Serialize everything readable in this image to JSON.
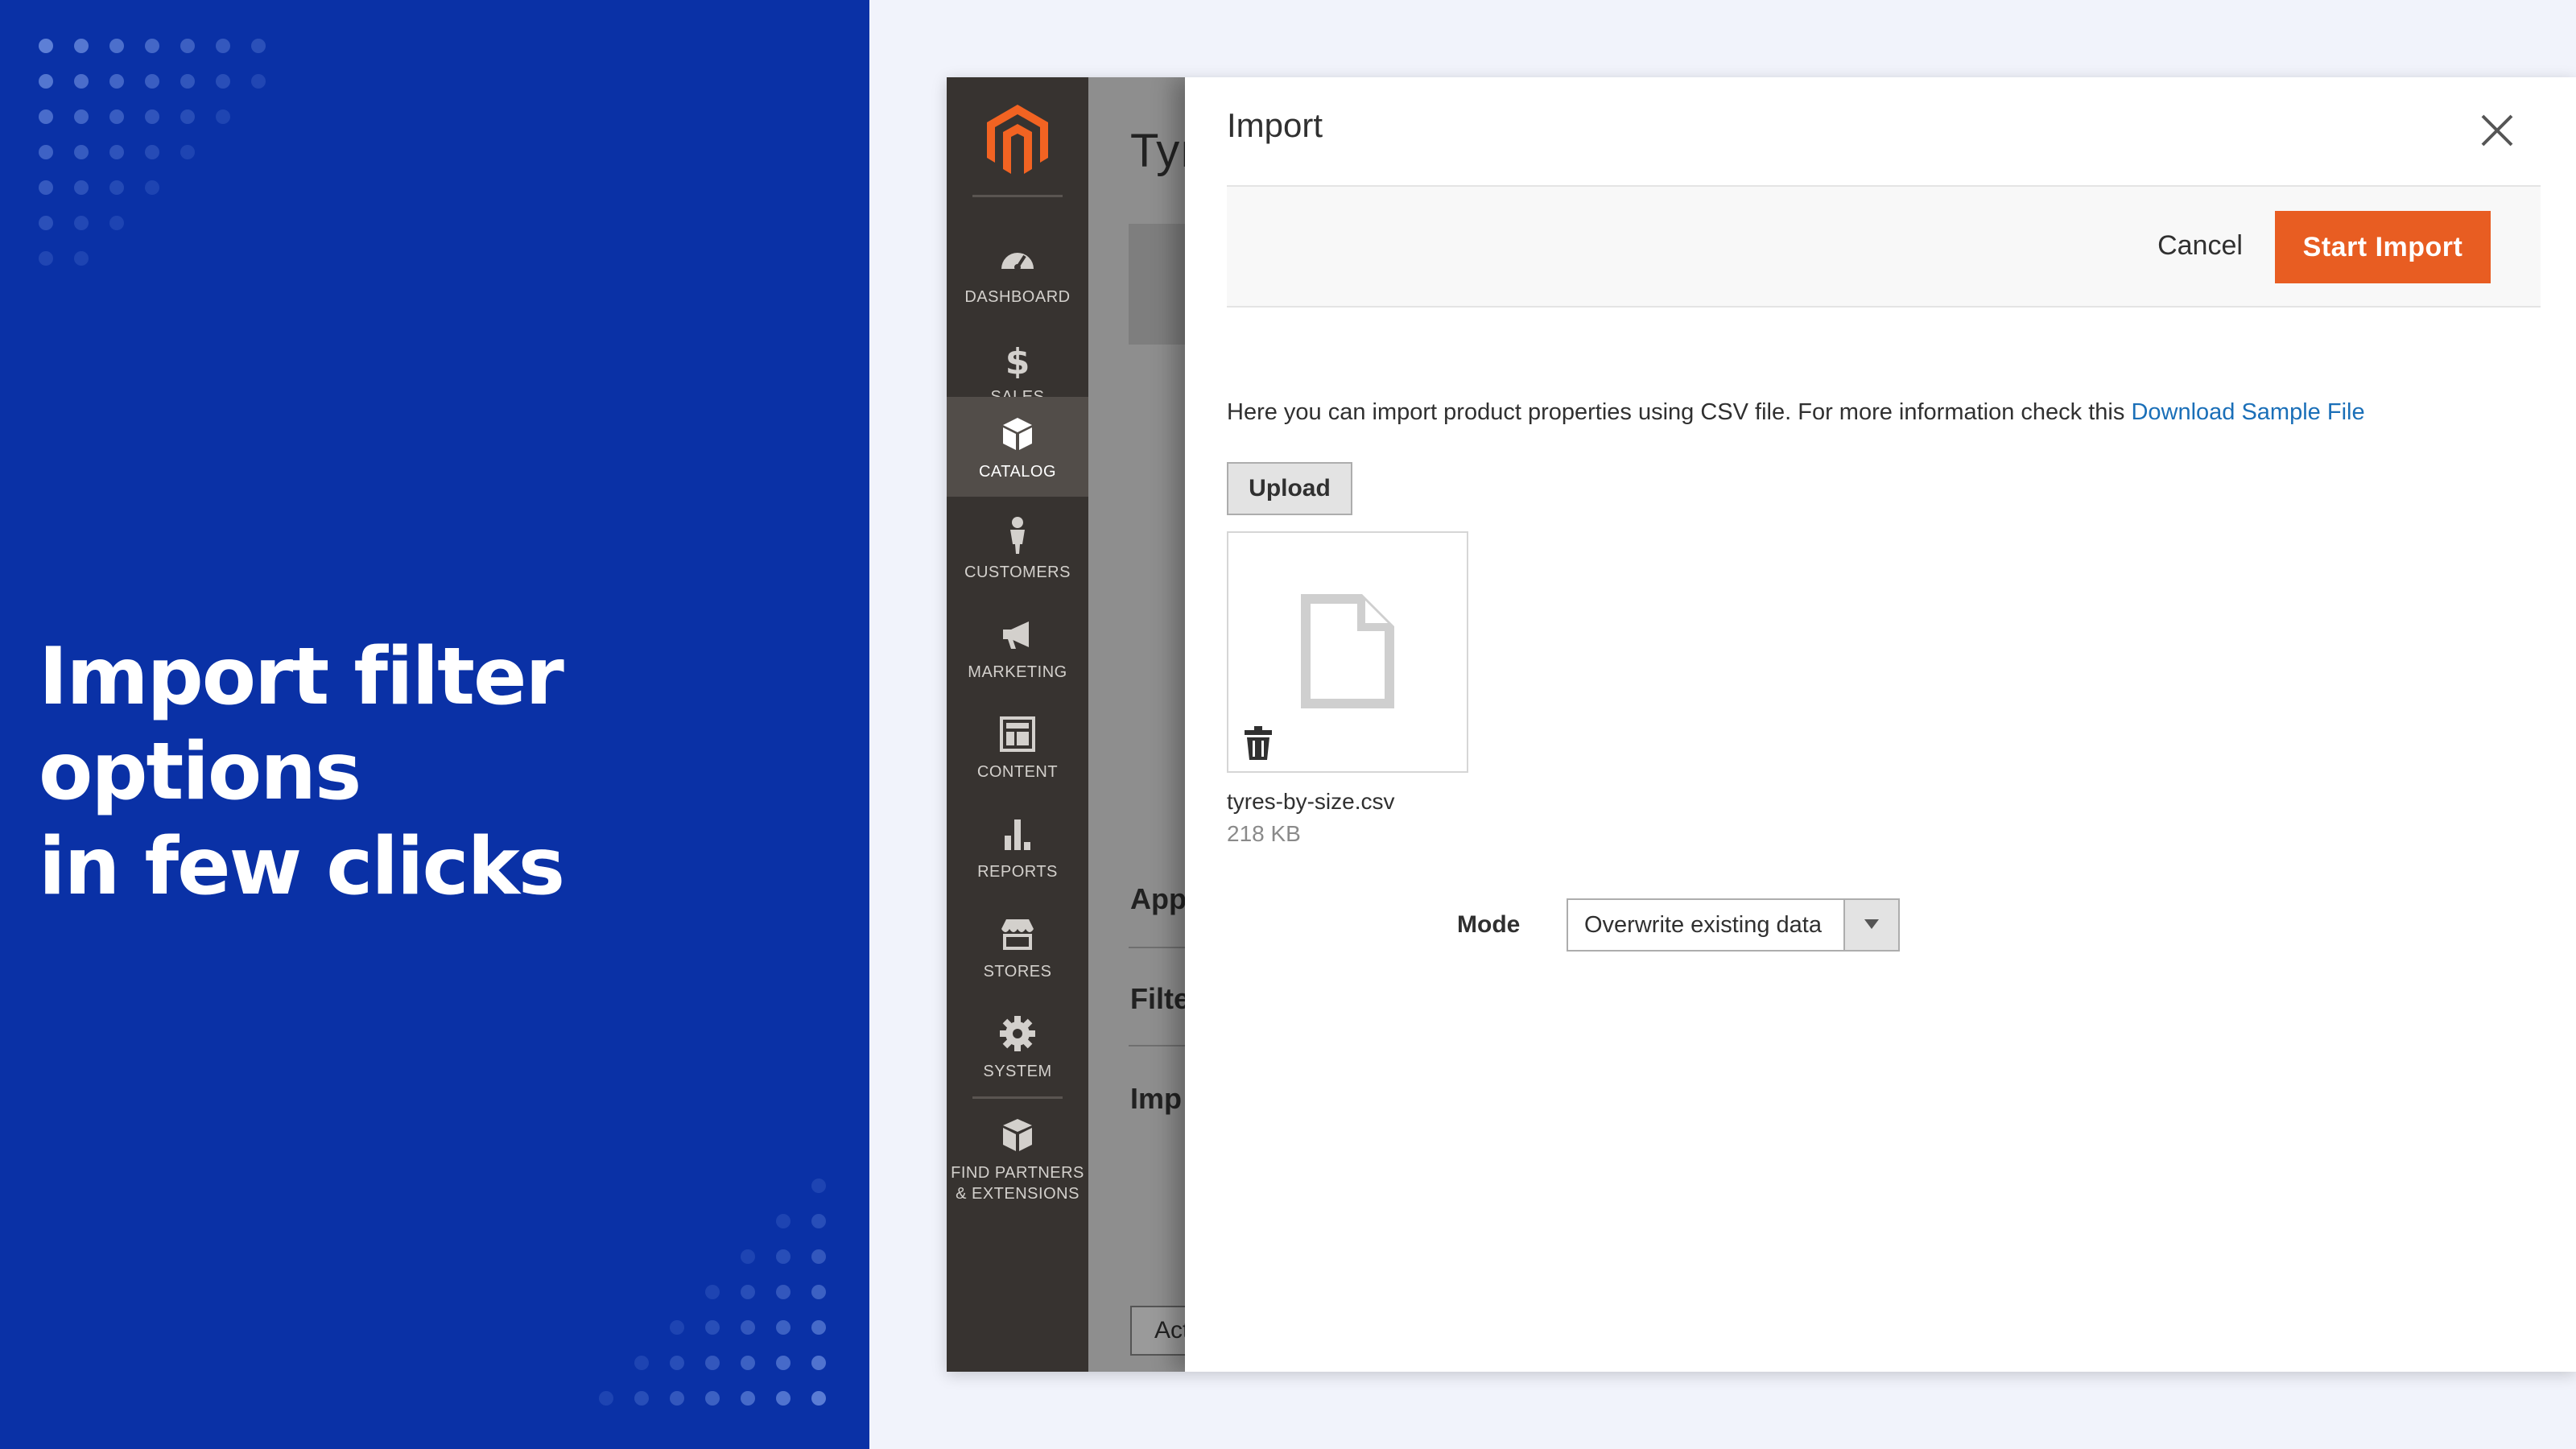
{
  "promo": {
    "headline_line1": "Import filter options",
    "headline_line2": "in few clicks"
  },
  "sidebar": {
    "items": [
      {
        "label": "DASHBOARD",
        "icon": "dashboard-icon",
        "active": false
      },
      {
        "label": "SALES",
        "icon": "dollar-icon",
        "active": false
      },
      {
        "label": "CATALOG",
        "icon": "box-icon",
        "active": true
      },
      {
        "label": "CUSTOMERS",
        "icon": "person-icon",
        "active": false
      },
      {
        "label": "MARKETING",
        "icon": "megaphone-icon",
        "active": false
      },
      {
        "label": "CONTENT",
        "icon": "layout-icon",
        "active": false
      },
      {
        "label": "REPORTS",
        "icon": "bar-chart-icon",
        "active": false
      },
      {
        "label": "STORES",
        "icon": "storefront-icon",
        "active": false
      },
      {
        "label": "SYSTEM",
        "icon": "gear-icon",
        "active": false
      }
    ],
    "extensions_line1": "FIND PARTNERS",
    "extensions_line2": "& EXTENSIONS"
  },
  "background_page": {
    "title_fragment": "Tyı",
    "sections": [
      "App",
      "Filte",
      "Imp"
    ],
    "button_fragment": "Act"
  },
  "modal": {
    "title": "Import",
    "cancel_label": "Cancel",
    "start_import_label": "Start Import",
    "info_text": "Here you can import product properties using CSV file. For more information check this ",
    "info_link": "Download Sample File",
    "upload_label": "Upload",
    "file": {
      "name": "tyres-by-size.csv",
      "size": "218 KB"
    },
    "mode_label": "Mode",
    "mode_value": "Overwrite existing data"
  },
  "colors": {
    "promo_bg": "#0a31a6",
    "accent": "#e85d22",
    "link": "#1a6fb8",
    "sidebar_bg": "#373330"
  }
}
